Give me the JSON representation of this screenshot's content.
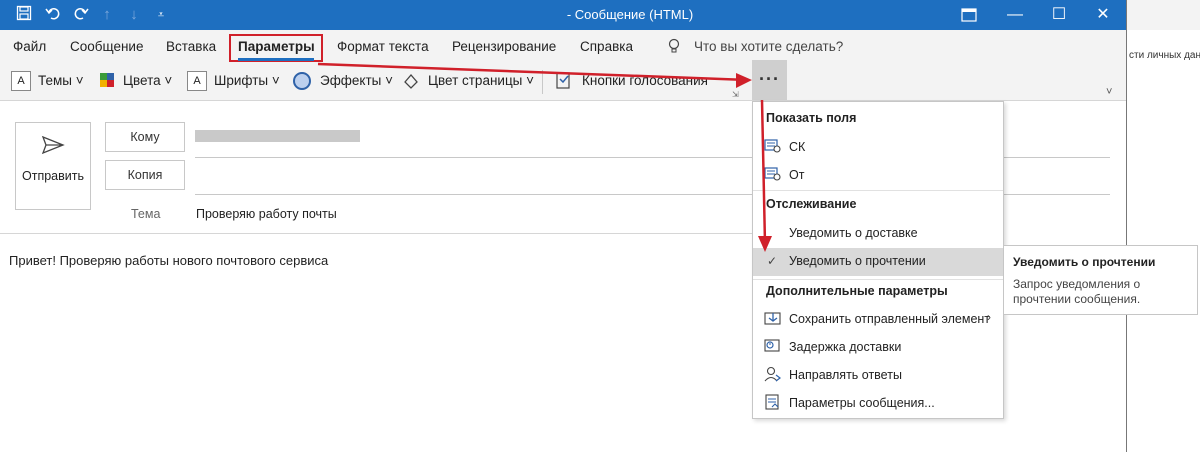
{
  "window": {
    "title": "- Сообщение (HTML)",
    "quick_access": {
      "save": "save-icon",
      "undo": "undo-icon",
      "redo": "redo-icon",
      "up": "arrow-up-icon",
      "down": "arrow-down-icon",
      "customize": "customize-icon"
    },
    "controls": {
      "restore": "restore-icon",
      "minimize": "minimize-icon",
      "maximize": "maximize-icon",
      "close": "close-icon"
    }
  },
  "menu": {
    "tabs": [
      "Файл",
      "Сообщение",
      "Вставка",
      "Параметры",
      "Формат текста",
      "Рецензирование",
      "Справка"
    ],
    "active_tab": "Параметры",
    "search_placeholder": "Что вы хотите сделать?"
  },
  "ribbon": {
    "themes": "Темы",
    "colors": "Цвета",
    "fonts": "Шрифты",
    "effects": "Эффекты",
    "page_color": "Цвет страницы",
    "voting_buttons": "Кнопки голосования",
    "more": "···"
  },
  "compose": {
    "send": "Отправить",
    "to_button": "Кому",
    "cc_button": "Копия",
    "subject_label": "Тема",
    "subject_value": "Проверяю работу почты",
    "body": "Привет! Проверяю работы нового почтового сервиса"
  },
  "dropdown": {
    "show_fields": "Показать поля",
    "bcc": "СК",
    "from": "От",
    "tracking": "Отслеживание",
    "delivery_receipt": "Уведомить о доставке",
    "read_receipt": "Уведомить о прочтении",
    "more_options": "Дополнительные параметры",
    "save_sent": "Сохранить отправленный элемент",
    "delay_delivery": "Задержка доставки",
    "direct_replies": "Направлять ответы",
    "message_options": "Параметры сообщения..."
  },
  "tooltip": {
    "title": "Уведомить о прочтении",
    "text_line1": "Запрос уведомления о",
    "text_line2": "прочтении сообщения."
  },
  "background_window": {
    "text": "сти личных данн"
  },
  "colors": {
    "titlebar": "#1e6fc0",
    "highlight": "#d0202a"
  }
}
